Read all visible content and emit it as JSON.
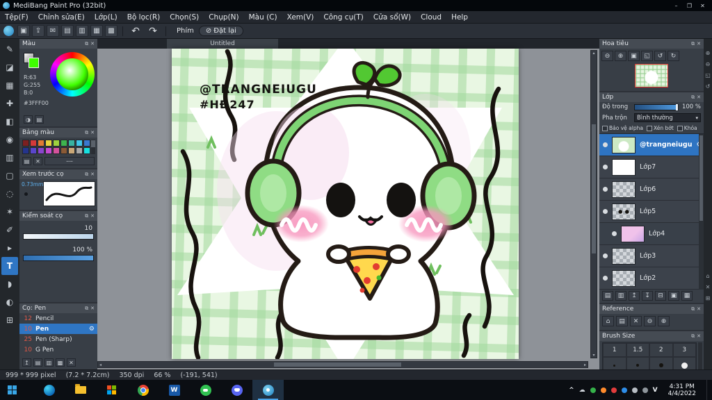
{
  "window": {
    "title": "MediBang Paint Pro (32bit)"
  },
  "titlebar": {
    "minimize": "–",
    "maximize": "❐",
    "close": "✕"
  },
  "menu": {
    "items": [
      {
        "label": "Tệp(F)"
      },
      {
        "label": "Chỉnh sửa(E)"
      },
      {
        "label": "Lớp(L)"
      },
      {
        "label": "Bộ lọc(R)"
      },
      {
        "label": "Chọn(S)"
      },
      {
        "label": "Chụp(N)"
      },
      {
        "label": "Màu (C)"
      },
      {
        "label": "Xem(V)"
      },
      {
        "label": "Công cụ(T)"
      },
      {
        "label": "Cửa sổ(W)"
      },
      {
        "label": "Cloud"
      },
      {
        "label": "Help"
      }
    ]
  },
  "toolbar": {
    "icons": [
      {
        "name": "save-icon",
        "glyph": "▣"
      },
      {
        "name": "export-icon",
        "glyph": "⇪"
      },
      {
        "name": "comment-icon",
        "glyph": "✉"
      },
      {
        "name": "document-icon",
        "glyph": "▤"
      },
      {
        "name": "documents-icon",
        "glyph": "▥"
      },
      {
        "name": "grid-icon",
        "glyph": "▦"
      },
      {
        "name": "grid-settings-icon",
        "glyph": "▩"
      }
    ],
    "undo": "↶",
    "redo": "↷",
    "phim_label": "Phím",
    "reset_icon": "⊘",
    "reset_label": "Đặt lại"
  },
  "tools": [
    {
      "name": "brush-tool",
      "glyph": "✎"
    },
    {
      "name": "eraser-tool",
      "glyph": "◪"
    },
    {
      "name": "dot-tool",
      "glyph": "▦"
    },
    {
      "name": "move-tool",
      "glyph": "✚"
    },
    {
      "name": "fill-tool",
      "glyph": "◧"
    },
    {
      "name": "bucket-tool",
      "glyph": "◉"
    },
    {
      "name": "gradient-tool",
      "glyph": "▥"
    },
    {
      "name": "select-tool",
      "glyph": "▢"
    },
    {
      "name": "lasso-tool",
      "glyph": "◌"
    },
    {
      "name": "magic-wand-tool",
      "glyph": "✶"
    },
    {
      "name": "select-pen-tool",
      "glyph": "✐"
    },
    {
      "name": "operation-tool",
      "glyph": "▸"
    },
    {
      "name": "text-tool",
      "glyph": "T"
    },
    {
      "name": "eyedropper-tool",
      "glyph": "◗"
    },
    {
      "name": "hand-tool",
      "glyph": "◐"
    },
    {
      "name": "divide-tool",
      "glyph": "⊞"
    }
  ],
  "panels": {
    "color": {
      "title": "Màu",
      "r": "R:63",
      "g": "G:255",
      "b": "B:0",
      "hex": "#3FFF00"
    },
    "palette": {
      "title": "Bảng màu",
      "colors": [
        "#7c2020",
        "#d43a3a",
        "#e07a34",
        "#e8d23e",
        "#9ed23e",
        "#3eb44e",
        "#38b2a0",
        "#40c4e8",
        "#3a78d0",
        "#24348c",
        "#5a46cc",
        "#8a46cc",
        "#c44ad0",
        "#d4529c",
        "#8a5a36",
        "#caa878",
        "#a8a8a8",
        "#18e0e0"
      ],
      "footer": [
        {
          "name": "add-color-icon",
          "glyph": "▤"
        },
        {
          "name": "delete-color-icon",
          "glyph": "✕"
        },
        {
          "name": "palette-menu",
          "glyph": "┄┄"
        }
      ]
    },
    "brush_preview": {
      "title": "Xem trước cọ",
      "size": "0.73mm"
    },
    "brush_control": {
      "title": "Kiểm soát cọ",
      "size_value": "10",
      "opacity_value": "100 %"
    },
    "brush_list": {
      "title": "Cọ: Pen",
      "brushes": [
        {
          "size": "12",
          "name": "Pencil"
        },
        {
          "size": "10",
          "name": "Pen"
        },
        {
          "size": "25",
          "name": "Pen (Sharp)"
        },
        {
          "size": "10",
          "name": "G Pen"
        }
      ],
      "footer": [
        {
          "name": "brush-up-icon",
          "glyph": "↥"
        },
        {
          "name": "add-brush-icon",
          "glyph": "▤"
        },
        {
          "name": "duplicate-brush-icon",
          "glyph": "▥"
        },
        {
          "name": "brush-settings-icon",
          "glyph": "▩"
        },
        {
          "name": "delete-brush-icon",
          "glyph": "✕"
        }
      ]
    },
    "navigator": {
      "title": "Hoa tiêu",
      "icons": [
        {
          "name": "zoom-out-icon",
          "glyph": "⊖"
        },
        {
          "name": "zoom-in-icon",
          "glyph": "⊕"
        },
        {
          "name": "zoom-reset-icon",
          "glyph": "▣"
        },
        {
          "name": "fit-screen-icon",
          "glyph": "◱"
        },
        {
          "name": "rotate-left-icon",
          "glyph": "↺"
        },
        {
          "name": "rotate-right-icon",
          "glyph": "↻"
        }
      ]
    },
    "layers": {
      "title": "Lớp",
      "opacity_label": "Độ trong",
      "opacity_value": "100 %",
      "blend_label": "Pha trộn",
      "blend_value": "Bình thường",
      "checkboxes": [
        "Bảo vệ alpha",
        "Xén bớt",
        "Khóa"
      ],
      "items": [
        {
          "name": "@trangneiugu"
        },
        {
          "name": "Lớp7"
        },
        {
          "name": "Lớp6"
        },
        {
          "name": "Lớp5"
        },
        {
          "name": "Lớp4"
        },
        {
          "name": "Lớp3"
        },
        {
          "name": "Lớp2"
        }
      ],
      "footer": [
        {
          "name": "new-layer-icon",
          "glyph": "▤"
        },
        {
          "name": "duplicate-layer-icon",
          "glyph": "▥"
        },
        {
          "name": "layer-up-icon",
          "glyph": "↥"
        },
        {
          "name": "layer-down-icon",
          "glyph": "↧"
        },
        {
          "name": "merge-layer-icon",
          "glyph": "⊟"
        },
        {
          "name": "layer-folder-icon",
          "glyph": "▣"
        },
        {
          "name": "layer-menu-icon",
          "glyph": "▦"
        }
      ]
    },
    "reference": {
      "title": "Reference",
      "icons": [
        {
          "name": "home-icon",
          "glyph": "⌂"
        },
        {
          "name": "open-image-icon",
          "glyph": "▤"
        },
        {
          "name": "clear-icon",
          "glyph": "✕"
        },
        {
          "name": "zoom-out-icon",
          "glyph": "⊖"
        },
        {
          "name": "zoom-in-icon",
          "glyph": "⊕"
        }
      ]
    },
    "brush_size": {
      "title": "Brush Size",
      "labels": [
        "1",
        "1.5",
        "2",
        "3"
      ]
    }
  },
  "edge_icons": [
    {
      "glyph": "⊕"
    },
    {
      "glyph": "⊖"
    },
    {
      "glyph": "◱"
    },
    {
      "glyph": "↺"
    },
    {
      "glyph": "⌂"
    },
    {
      "glyph": "✕"
    },
    {
      "glyph": "⊞"
    }
  ],
  "canvas": {
    "tab_title": "Untitled",
    "artwork": {
      "handle": "@TRANGNEIUGU",
      "hashtag": "#HĐ247",
      "colors": {
        "plaid_bg": "#e9f7e3",
        "plaid_stripe": "#a2d89c",
        "outline": "#1c1410",
        "headphone": "#8fdc84",
        "blush": "#f795bd",
        "cheese": "#ffd84d",
        "pepperoni": "#e23c30",
        "sprout": "#52c832"
      }
    }
  },
  "status": {
    "dimensions": "999 * 999 pixel",
    "physical": "(7.2 * 7.2cm)",
    "dpi": "350 dpi",
    "zoom": "66 %",
    "coords": "(-191, 541)"
  },
  "taskbar": {
    "tray_expand": "^",
    "cloud_icon": "☁",
    "unikey": "V",
    "clock": {
      "time": "4:31 PM",
      "date": "4/4/2022"
    }
  }
}
